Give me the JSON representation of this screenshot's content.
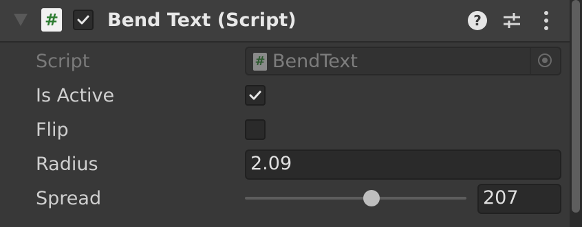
{
  "component": {
    "title": "Bend Text (Script)",
    "enabled": true,
    "script_icon_glyph": "#",
    "icons": {
      "foldout": "foldout-arrow-icon",
      "script": "script-icon",
      "help": "help-icon",
      "presets": "presets-icon",
      "menu": "kebab-menu-icon"
    },
    "help_glyph": "?"
  },
  "fields": {
    "script": {
      "label": "Script",
      "value": "BendText",
      "icon_glyph": "#"
    },
    "is_active": {
      "label": "Is Active",
      "checked": true
    },
    "flip": {
      "label": "Flip",
      "checked": false
    },
    "radius": {
      "label": "Radius",
      "value": "2.09"
    },
    "spread": {
      "label": "Spread",
      "value": "207",
      "slider_fraction": 0.57
    }
  },
  "colors": {
    "background": "#383838",
    "header": "#3e3e3e",
    "label": "#cfcfcf",
    "disabled_label": "#7a7a7a",
    "script_icon_green": "#2e7d32"
  }
}
